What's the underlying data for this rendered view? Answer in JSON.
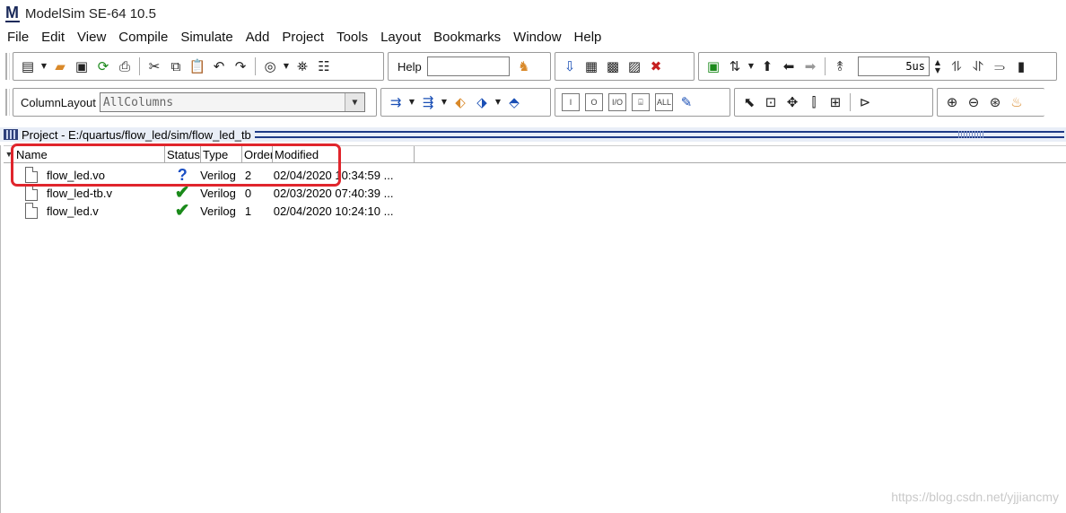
{
  "window": {
    "title": "ModelSim SE-64 10.5"
  },
  "menubar": {
    "items": [
      "File",
      "Edit",
      "View",
      "Compile",
      "Simulate",
      "Add",
      "Project",
      "Tools",
      "Layout",
      "Bookmarks",
      "Window",
      "Help"
    ]
  },
  "toolbar": {
    "help_label": "Help",
    "help_value": "",
    "run_length": "5us",
    "column_layout_label": "ColumnLayout",
    "column_layout_value": "AllColumns",
    "wave_btn_i": "I",
    "wave_btn_o": "O",
    "wave_btn_io": "I/O",
    "wave_btn_all": "ALL"
  },
  "project": {
    "title": "Project - E:/quartus/flow_led/sim/flow_led_tb",
    "columns": [
      "Name",
      "Status",
      "Type",
      "Order",
      "Modified"
    ],
    "files": [
      {
        "name": "flow_led.vo",
        "status": "unknown",
        "type": "Verilog",
        "order": "2",
        "modified": "02/04/2020 10:34:59 ..."
      },
      {
        "name": "flow_led-tb.v",
        "status": "compiled",
        "type": "Verilog",
        "order": "0",
        "modified": "02/03/2020 07:40:39 ..."
      },
      {
        "name": "flow_led.v",
        "status": "compiled",
        "type": "Verilog",
        "order": "1",
        "modified": "02/04/2020 10:24:10 ..."
      }
    ]
  },
  "watermark": "https://blog.csdn.net/yjjiancmy",
  "colors": {
    "highlight": "#e0252c",
    "pane_rule": "#1f3b86",
    "check": "#1a8a1a",
    "question": "#1a4fc4"
  }
}
